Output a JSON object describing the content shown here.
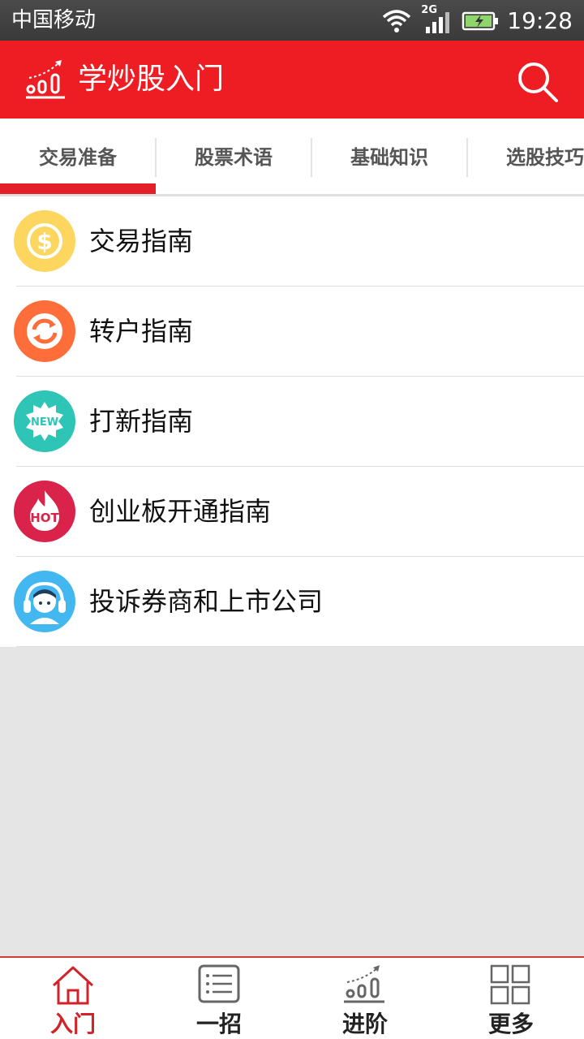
{
  "status_bar": {
    "carrier": "中国移动",
    "network": "2G",
    "time": "19:28"
  },
  "app_bar": {
    "title": "学炒股入门",
    "logo_icon": "chart-growth-icon",
    "search_icon": "search-icon"
  },
  "tabs": [
    {
      "label": "交易准备",
      "active": true
    },
    {
      "label": "股票术语",
      "active": false
    },
    {
      "label": "基础知识",
      "active": false
    },
    {
      "label": "选股技巧",
      "active": false
    }
  ],
  "list_items": [
    {
      "label": "交易指南",
      "icon": "dollar-icon",
      "icon_color": "#fdd660"
    },
    {
      "label": "转户指南",
      "icon": "transfer-icon",
      "icon_color": "#ff6d3a"
    },
    {
      "label": "打新指南",
      "icon": "new-badge-icon",
      "icon_color": "#2ec4b6",
      "badge_text": "NEW"
    },
    {
      "label": "创业板开通指南",
      "icon": "hot-flame-icon",
      "icon_color": "#d9234a",
      "badge_text": "HOT"
    },
    {
      "label": "投诉券商和上市公司",
      "icon": "support-agent-icon",
      "icon_color": "#43b8f0"
    }
  ],
  "bottom_nav": [
    {
      "label": "入门",
      "icon": "home-icon",
      "active": true
    },
    {
      "label": "一招",
      "icon": "list-icon",
      "active": false
    },
    {
      "label": "进阶",
      "icon": "chart-growth-icon",
      "active": false
    },
    {
      "label": "更多",
      "icon": "grid-icon",
      "active": false
    }
  ],
  "colors": {
    "accent": "#ee1d23",
    "tab_indicator": "#e32027",
    "background": "#e5e5e5"
  }
}
